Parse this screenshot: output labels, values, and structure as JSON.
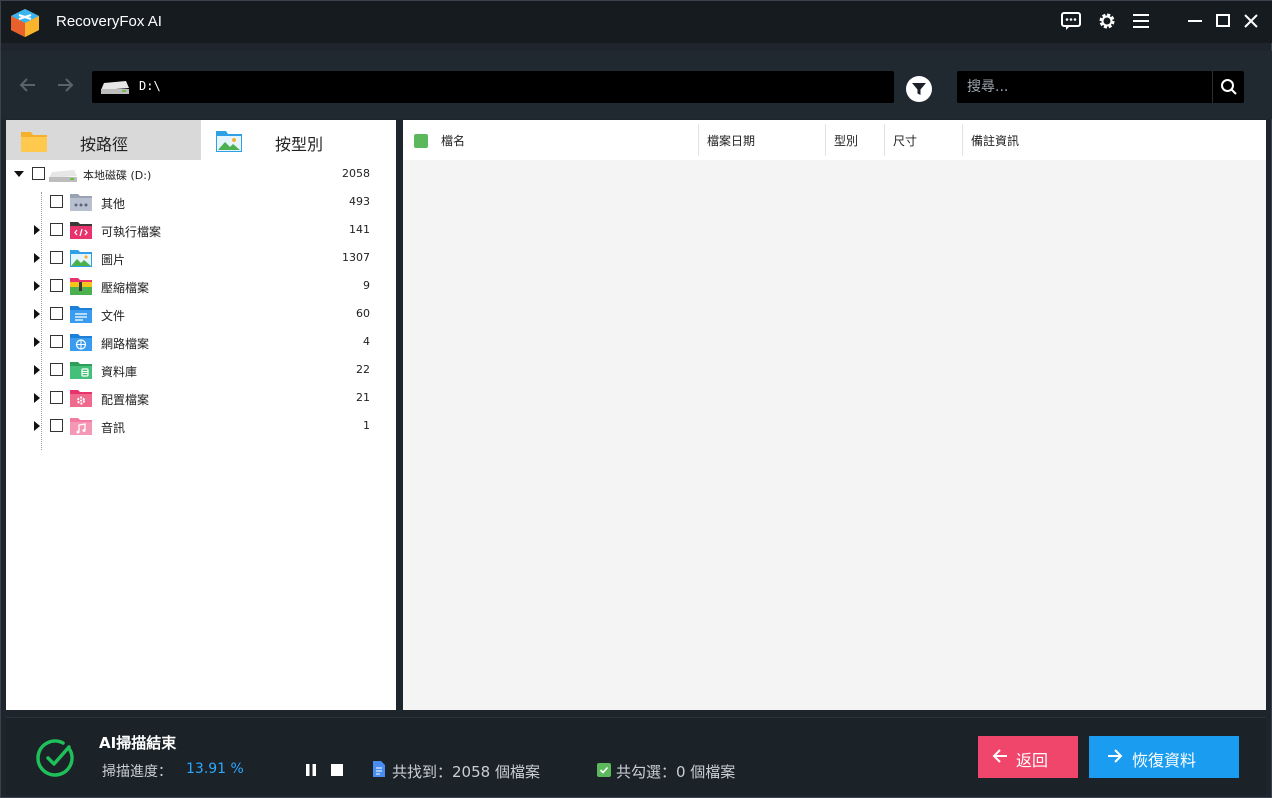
{
  "app": {
    "title": "RecoveryFox AI"
  },
  "titlebar": {
    "icons": [
      "feedback-icon",
      "settings-icon",
      "menu-icon",
      "minimize-icon",
      "maximize-icon",
      "close-icon"
    ]
  },
  "navbar": {
    "path": "D:\\",
    "search_placeholder": "搜尋..."
  },
  "left_panel": {
    "tabs": [
      {
        "label": "按路徑",
        "icon": "folder-icon",
        "active": false
      },
      {
        "label": "按型別",
        "icon": "image-folder-icon",
        "active": true
      }
    ],
    "root": {
      "label": "本地磁碟 (D:)",
      "count": "2058"
    },
    "items": [
      {
        "label": "其他",
        "count": "493",
        "icon": "other-folder-icon",
        "expandable": false
      },
      {
        "label": "可執行檔案",
        "count": "141",
        "icon": "executable-folder-icon",
        "expandable": true
      },
      {
        "label": "圖片",
        "count": "1307",
        "icon": "picture-folder-icon",
        "expandable": true
      },
      {
        "label": "壓縮檔案",
        "count": "9",
        "icon": "archive-folder-icon",
        "expandable": true
      },
      {
        "label": "文件",
        "count": "60",
        "icon": "document-folder-icon",
        "expandable": true
      },
      {
        "label": "網路檔案",
        "count": "4",
        "icon": "web-folder-icon",
        "expandable": true
      },
      {
        "label": "資料庫",
        "count": "22",
        "icon": "database-folder-icon",
        "expandable": true
      },
      {
        "label": "配置檔案",
        "count": "21",
        "icon": "config-folder-icon",
        "expandable": true
      },
      {
        "label": "音訊",
        "count": "1",
        "icon": "audio-folder-icon",
        "expandable": true
      }
    ]
  },
  "table": {
    "columns": [
      "檔名",
      "檔案日期",
      "型別",
      "尺寸",
      "備註資訊"
    ],
    "rows": []
  },
  "bottom": {
    "scan_title": "AI掃描結束",
    "progress_label": "掃描進度：",
    "progress_value": "13.91 %",
    "found_text": "共找到：2058 個檔案",
    "selected_text": "共勾選：0 個檔案",
    "back_label": "返回",
    "recover_label": "恢復資料"
  },
  "colors": {
    "accent_blue": "#1a9cf0",
    "back_red": "#f0466b",
    "check_green": "#5cb85c",
    "progress_blue": "#2ea7ff"
  }
}
